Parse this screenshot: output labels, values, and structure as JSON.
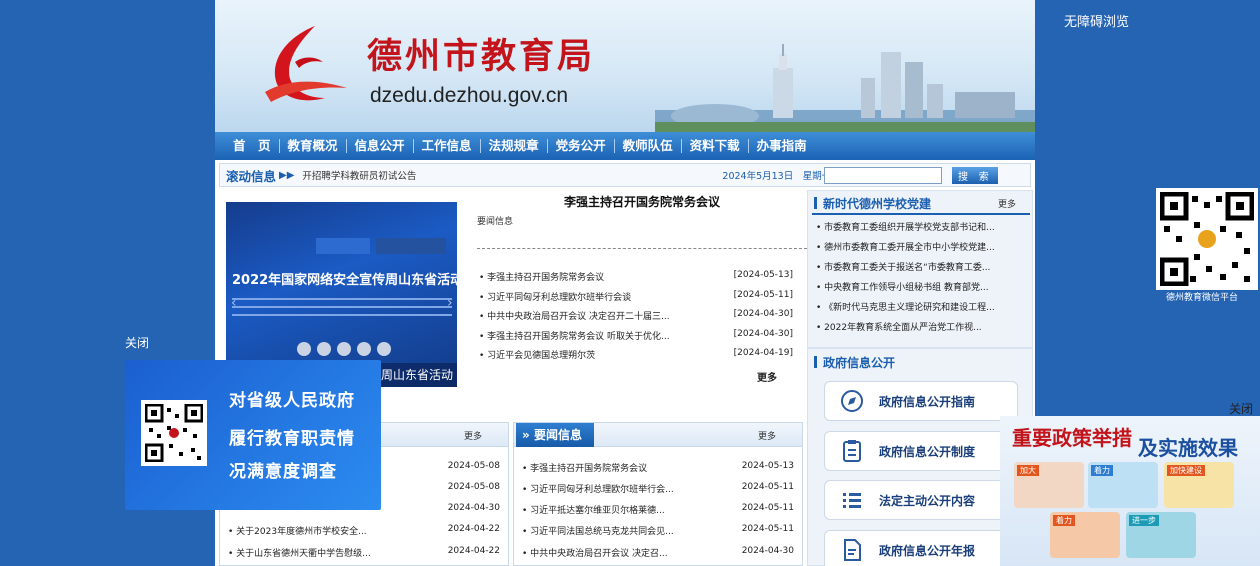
{
  "site": {
    "title": "德州市教育局",
    "domain": "dzedu.dezhou.gov.cn"
  },
  "nav": [
    "首　页",
    "教育概况",
    "信息公开",
    "工作信息",
    "法规规章",
    "党务公开",
    "教师队伍",
    "资料下载",
    "办事指南"
  ],
  "ticker": {
    "title": "滚动信息",
    "text": "开招聘学科教研员初试公告",
    "date": "2024年5月13日　星期一",
    "search_label": "搜 索",
    "search_value": ""
  },
  "slide": {
    "caption": "2022年国家网络安全宣传周山东省活动",
    "bottom_text": "周山东省活动"
  },
  "headline": {
    "title": "李强主持召开国务院常务会议",
    "subtitle": "要闻信息",
    "more": "更多",
    "items": [
      {
        "title": "李强主持召开国务院常务会议",
        "date": "[2024-05-13]"
      },
      {
        "title": "习近平同匈牙利总理欧尔班举行会谈",
        "date": "[2024-05-11]"
      },
      {
        "title": "中共中央政治局召开会议 决定召开二十届三...",
        "date": "[2024-04-30]"
      },
      {
        "title": "李强主持召开国务院常务会议 听取关于优化...",
        "date": "[2024-04-30]"
      },
      {
        "title": "习近平会见德国总理朔尔茨",
        "date": "[2024-04-19]"
      }
    ]
  },
  "left_panel": {
    "more": "更多",
    "items": [
      {
        "title": "",
        "date": "2024-05-08"
      },
      {
        "title": "...",
        "date": "2024-05-08"
      },
      {
        "title": "...",
        "date": "2024-04-30"
      },
      {
        "title": "关于2023年度德州市学校安全...",
        "date": "2024-04-22"
      },
      {
        "title": "关于山东省德州天衢中学告慰级...",
        "date": "2024-04-22"
      }
    ]
  },
  "news_panel": {
    "title": "要闻信息",
    "more": "更多",
    "items": [
      {
        "title": "李强主持召开国务院常务会议",
        "date": "2024-05-13"
      },
      {
        "title": "习近平同匈牙利总理欧尔班举行会...",
        "date": "2024-05-11"
      },
      {
        "title": "习近平抵达塞尔维亚贝尔格莱德...",
        "date": "2024-05-11"
      },
      {
        "title": "习近平同法国总统马克龙共同会见...",
        "date": "2024-05-11"
      },
      {
        "title": "中共中央政治局召开会议 决定召...",
        "date": "2024-04-30"
      }
    ]
  },
  "party": {
    "title": "新时代德州学校党建",
    "more": "更多",
    "items": [
      "市委教育工委组织开展学校党支部书记和...",
      "德州市委教育工委开展全市中小学校党建...",
      "市委教育工委关于报送名“市委教育工委...",
      "中央教育工作领导小组秘书组  教育部党...",
      "《新时代马克思主义理论研究和建设工程...",
      "2022年教育系统全面从严治党工作视..."
    ]
  },
  "gov": {
    "title": "政府信息公开",
    "buttons": [
      "政府信息公开指南",
      "政府信息公开制度",
      "法定主动公开内容",
      "政府信息公开年报"
    ]
  },
  "floating": {
    "accessibility": "无障碍浏览",
    "qr_label": "德州教育微信平台",
    "close_left": "关闭",
    "close_right": "关闭",
    "survey_lines": [
      "对省级人民政府",
      "履行教育职责情",
      "况满意度调查"
    ],
    "policy_title_1": "重要政策举措",
    "policy_title_2": "及实施效果",
    "policy_tags": [
      "加大",
      "着力",
      "加快建设",
      "着力",
      "进一步"
    ]
  },
  "colors": {
    "page_bg": "#2563b3",
    "brand_red": "#c4141b",
    "nav_blue": "#1b63b4"
  }
}
